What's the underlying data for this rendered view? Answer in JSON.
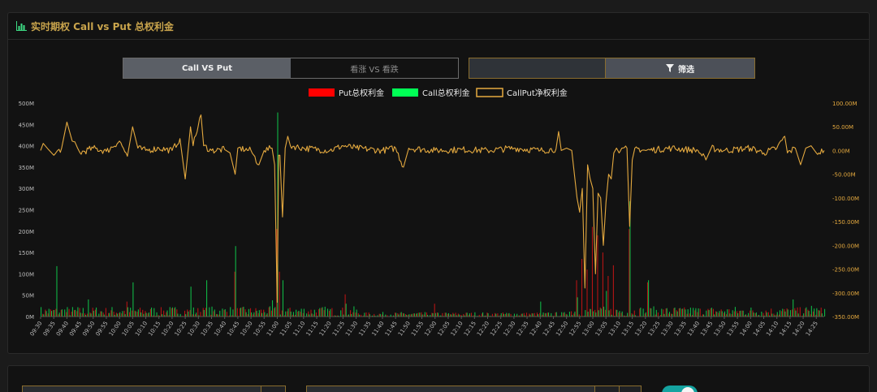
{
  "panel": {
    "title": "实时期权 Call vs Put 总权利金"
  },
  "tabs": [
    {
      "label": "Call VS Put",
      "active": true
    },
    {
      "label": "看涨 VS 看跌",
      "active": false
    }
  ],
  "filter": {
    "button_label": "筛选"
  },
  "colors": {
    "put": "#ff0000",
    "call": "#00ff55",
    "net": "#e4a93f",
    "accent": "#c9a44c",
    "toggle": "#15a3a0"
  },
  "chart_data": {
    "type": "bar",
    "legend": [
      "Put总权利金",
      "Call总权利金",
      "CallPut净权利金"
    ],
    "legend_position": "top-center",
    "y_left": {
      "ticks": [
        "0M",
        "50M",
        "100M",
        "150M",
        "200M",
        "250M",
        "300M",
        "350M",
        "400M",
        "450M",
        "500M"
      ],
      "ylim": [
        0,
        500
      ]
    },
    "y_right": {
      "ticks": [
        "-350.00M",
        "-300.00M",
        "-250.00M",
        "-200.00M",
        "-150.00M",
        "-100.00M",
        "-50.00M",
        "0.00M",
        "50.00M",
        "100.00M"
      ],
      "ylim": [
        -350,
        100
      ]
    },
    "x_ticks": [
      "09:30",
      "09:35",
      "09:40",
      "09:45",
      "09:50",
      "09:55",
      "10:00",
      "10:05",
      "10:10",
      "10:15",
      "10:20",
      "10:25",
      "10:30",
      "10:35",
      "10:40",
      "10:45",
      "10:50",
      "10:55",
      "11:00",
      "11:05",
      "11:10",
      "11:15",
      "11:20",
      "11:25",
      "11:30",
      "11:35",
      "11:40",
      "11:45",
      "11:50",
      "11:55",
      "12:00",
      "12:05",
      "12:10",
      "12:15",
      "12:20",
      "12:25",
      "12:30",
      "12:35",
      "12:40",
      "12:45",
      "12:50",
      "12:55",
      "13:00",
      "13:05",
      "13:10",
      "13:15",
      "13:20",
      "13:25",
      "13:30",
      "13:35",
      "13:40",
      "13:45",
      "13:50",
      "13:55",
      "14:00",
      "14:05",
      "14:10",
      "14:15",
      "14:20",
      "14:25"
    ],
    "x_range": [
      "09:30",
      "14:28"
    ],
    "spikes": {
      "put": [
        [
          "10:03",
          35
        ],
        [
          "10:44",
          105
        ],
        [
          "11:00",
          205
        ],
        [
          "11:01",
          105
        ],
        [
          "11:26",
          52
        ],
        [
          "12:00",
          30
        ],
        [
          "12:54",
          85
        ],
        [
          "12:56",
          135
        ],
        [
          "12:58",
          110
        ],
        [
          "13:00",
          210
        ],
        [
          "13:02",
          190
        ],
        [
          "13:04",
          150
        ],
        [
          "13:06",
          95
        ],
        [
          "13:08",
          120
        ],
        [
          "13:14",
          205
        ],
        [
          "13:21",
          80
        ]
      ],
      "call": [
        [
          "09:36",
          118
        ],
        [
          "09:48",
          40
        ],
        [
          "10:05",
          80
        ],
        [
          "10:27",
          70
        ],
        [
          "10:33",
          85
        ],
        [
          "10:44",
          165
        ],
        [
          "10:58",
          38
        ],
        [
          "11:00",
          478
        ],
        [
          "11:02",
          85
        ],
        [
          "11:26",
          30
        ],
        [
          "12:40",
          35
        ],
        [
          "12:54",
          45
        ],
        [
          "13:05",
          60
        ],
        [
          "13:14",
          270
        ],
        [
          "13:21",
          85
        ],
        [
          "14:16",
          40
        ],
        [
          "14:23",
          25
        ]
      ]
    },
    "net_anchors": [
      [
        "09:30",
        0
      ],
      [
        "09:31",
        15
      ],
      [
        "09:33",
        2
      ],
      [
        "09:35",
        -10
      ],
      [
        "09:38",
        5
      ],
      [
        "09:40",
        60
      ],
      [
        "09:42",
        20
      ],
      [
        "09:45",
        -5
      ],
      [
        "09:50",
        5
      ],
      [
        "09:55",
        -2
      ],
      [
        "10:00",
        20
      ],
      [
        "10:03",
        -12
      ],
      [
        "10:05",
        50
      ],
      [
        "10:07",
        5
      ],
      [
        "10:10",
        0
      ],
      [
        "10:15",
        5
      ],
      [
        "10:20",
        0
      ],
      [
        "10:23",
        25
      ],
      [
        "10:25",
        -60
      ],
      [
        "10:27",
        50
      ],
      [
        "10:28",
        10
      ],
      [
        "10:31",
        75
      ],
      [
        "10:32",
        10
      ],
      [
        "10:35",
        0
      ],
      [
        "10:40",
        2
      ],
      [
        "10:42",
        -5
      ],
      [
        "10:44",
        -50
      ],
      [
        "10:45",
        5
      ],
      [
        "10:50",
        0
      ],
      [
        "10:53",
        -30
      ],
      [
        "10:55",
        0
      ],
      [
        "10:58",
        5
      ],
      [
        "10:59",
        -30
      ],
      [
        "11:00",
        -320
      ],
      [
        "11:00:30",
        -10
      ],
      [
        "11:01",
        -10
      ],
      [
        "11:02",
        -140
      ],
      [
        "11:03",
        5
      ],
      [
        "11:04",
        30
      ],
      [
        "11:05",
        10
      ],
      [
        "11:10",
        5
      ],
      [
        "11:20",
        0
      ],
      [
        "11:25",
        10
      ],
      [
        "11:30",
        5
      ],
      [
        "11:40",
        0
      ],
      [
        "11:45",
        5
      ],
      [
        "11:48",
        -35
      ],
      [
        "11:50",
        5
      ],
      [
        "12:00",
        0
      ],
      [
        "12:10",
        2
      ],
      [
        "12:20",
        0
      ],
      [
        "12:30",
        5
      ],
      [
        "12:40",
        0
      ],
      [
        "12:46",
        3
      ],
      [
        "12:47",
        40
      ],
      [
        "12:48",
        0
      ],
      [
        "12:50",
        5
      ],
      [
        "12:52",
        0
      ],
      [
        "12:54",
        -100
      ],
      [
        "12:55",
        -130
      ],
      [
        "12:56",
        -80
      ],
      [
        "12:57",
        -290
      ],
      [
        "12:58",
        -30
      ],
      [
        "12:59",
        -60
      ],
      [
        "13:00",
        -80
      ],
      [
        "13:01",
        -260
      ],
      [
        "13:02",
        -90
      ],
      [
        "13:03",
        -100
      ],
      [
        "13:04",
        -200
      ],
      [
        "13:05",
        -110
      ],
      [
        "13:06",
        -50
      ],
      [
        "13:07",
        -60
      ],
      [
        "13:08",
        -5
      ],
      [
        "13:09",
        5
      ],
      [
        "13:10",
        -5
      ],
      [
        "13:13",
        5
      ],
      [
        "13:14",
        -160
      ],
      [
        "13:15",
        -20
      ],
      [
        "13:16",
        5
      ],
      [
        "13:20",
        0
      ],
      [
        "13:30",
        5
      ],
      [
        "13:40",
        0
      ],
      [
        "13:43",
        -20
      ],
      [
        "13:45",
        5
      ],
      [
        "13:50",
        0
      ],
      [
        "14:00",
        5
      ],
      [
        "14:05",
        -5
      ],
      [
        "14:10",
        5
      ],
      [
        "14:13",
        30
      ],
      [
        "14:14",
        -5
      ],
      [
        "14:17",
        5
      ],
      [
        "14:19",
        -30
      ],
      [
        "14:21",
        5
      ],
      [
        "14:23",
        10
      ],
      [
        "14:25",
        -5
      ],
      [
        "14:28",
        0
      ]
    ]
  }
}
